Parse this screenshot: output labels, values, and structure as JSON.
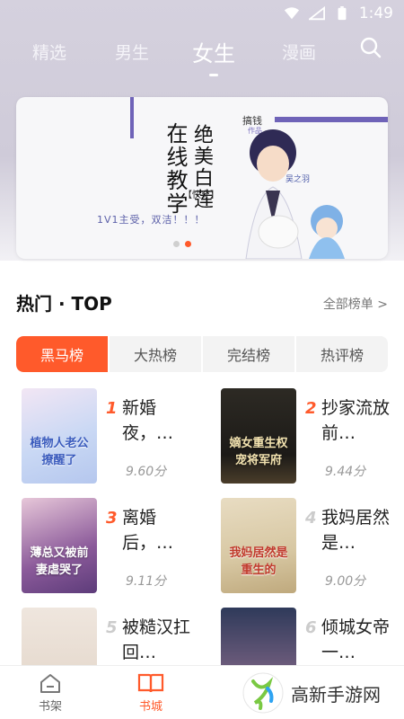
{
  "status_bar": {
    "time": "1:49"
  },
  "nav": {
    "tabs": [
      {
        "label": "精选"
      },
      {
        "label": "男生"
      },
      {
        "label": "女生"
      },
      {
        "label": "漫画"
      }
    ],
    "active": "女生"
  },
  "banner": {
    "title_a": "在线教学",
    "title_b": "绝美白莲",
    "tag": "【快穿】",
    "subtitle": "1V1主受，双洁！！！",
    "brand": "搞钱",
    "brand_sub": "作品",
    "name_tag": "吴之羽",
    "dot_count": 2,
    "active_dot": 1
  },
  "section": {
    "title": "热门 · TOP",
    "more_label": "全部榜单 >"
  },
  "rank_tabs": [
    {
      "label": "黑马榜"
    },
    {
      "label": "大热榜"
    },
    {
      "label": "完结榜"
    },
    {
      "label": "热评榜"
    }
  ],
  "books": [
    {
      "rank": "1",
      "title": "新婚夜，…",
      "score": "9.60分",
      "cover_text": "植物人老公撩醒了"
    },
    {
      "rank": "2",
      "title": "抄家流放前…",
      "score": "9.44分",
      "cover_text": "嫡女重生权宠将军府"
    },
    {
      "rank": "3",
      "title": "离婚后，…",
      "score": "9.11分",
      "cover_text": "薄总又被前妻虐哭了"
    },
    {
      "rank": "4",
      "title": "我妈居然是…",
      "score": "9.00分",
      "cover_text": "我妈居然是重生的"
    },
    {
      "rank": "5",
      "title": "被糙汉扛回…",
      "score": "",
      "cover_text": ""
    },
    {
      "rank": "6",
      "title": "倾城女帝一…",
      "score": "",
      "cover_text": ""
    }
  ],
  "bottom_nav": [
    {
      "label": "书架",
      "icon": "home-icon"
    },
    {
      "label": "书城",
      "icon": "book-icon"
    }
  ],
  "watermark": {
    "text": "高新手游网"
  },
  "colors": {
    "accent": "#ff5a2b",
    "header_bg": "#d2cedc",
    "banner_accent": "#6f63b8"
  }
}
